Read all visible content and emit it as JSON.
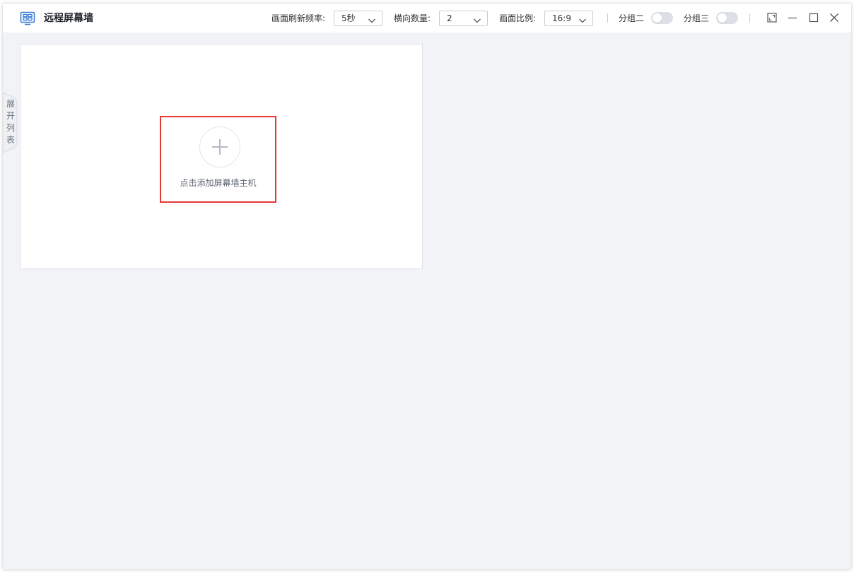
{
  "window": {
    "title": "远程屏幕墙",
    "accent_color": "#3a7bd5",
    "icons": {
      "app": "screen-wall-icon",
      "fullscreen": "fullscreen-icon",
      "minimize": "minimize-icon",
      "maximize": "maximize-icon",
      "close": "close-icon"
    }
  },
  "toolbar": {
    "refresh_label": "画面刷新频率:",
    "refresh_value": "5秒",
    "columns_label": "横向数量:",
    "columns_value": "2",
    "ratio_label": "画面比例:",
    "ratio_value": "16:9",
    "group2_label": "分组二",
    "group2_on": false,
    "group3_label": "分组三",
    "group3_on": false
  },
  "sidebar": {
    "expand_label": "展开列表"
  },
  "main": {
    "add_host_label": "点击添加屏幕墙主机",
    "add_icon": "plus-icon",
    "highlight_color": "#e53935"
  }
}
